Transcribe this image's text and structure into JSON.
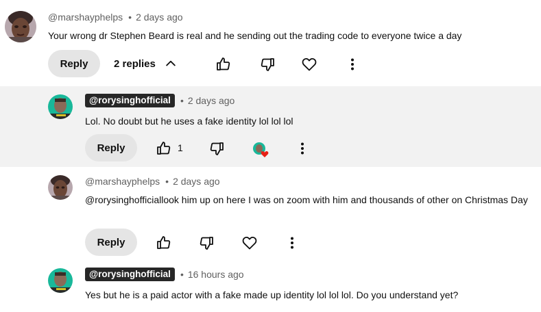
{
  "comments": [
    {
      "handle": "@marshayphelps",
      "time": "2 days ago",
      "text": "Your wrong dr Stephen Beard is real and he sending out the trading code to everyone twice a day",
      "reply_label": "Reply",
      "replies_label": "2 replies"
    },
    {
      "handle": "@rorysinghofficial",
      "time": "2 days ago",
      "text": "Lol. No doubt but he uses a fake identity lol lol lol",
      "reply_label": "Reply",
      "like_count": "1"
    },
    {
      "handle": "@marshayphelps",
      "time": "2 days ago",
      "text": "@rorysinghofficiallook him up on here I was on zoom with him and thousands of other on Christmas Day",
      "reply_label": "Reply"
    },
    {
      "handle": "@rorysinghofficial",
      "time": "16 hours ago",
      "text": "Yes but he is a paid actor with a fake made up identity lol lol lol. Do you  understand yet?",
      "reply_label": "Reply"
    }
  ],
  "separator": "•",
  "icons": {
    "like": "thumb-up-icon",
    "dislike": "thumb-down-icon",
    "heart": "heart-icon",
    "more": "more-vert-icon",
    "chevron": "chevron-up-icon",
    "creator_heart": "creator-heart-icon"
  },
  "colors": {
    "highlight_bg": "#f2f2f2",
    "button_bg": "#e5e5e5",
    "handle_pill": "#272727",
    "meta_text": "#606060",
    "heart_red": "#e62117"
  }
}
